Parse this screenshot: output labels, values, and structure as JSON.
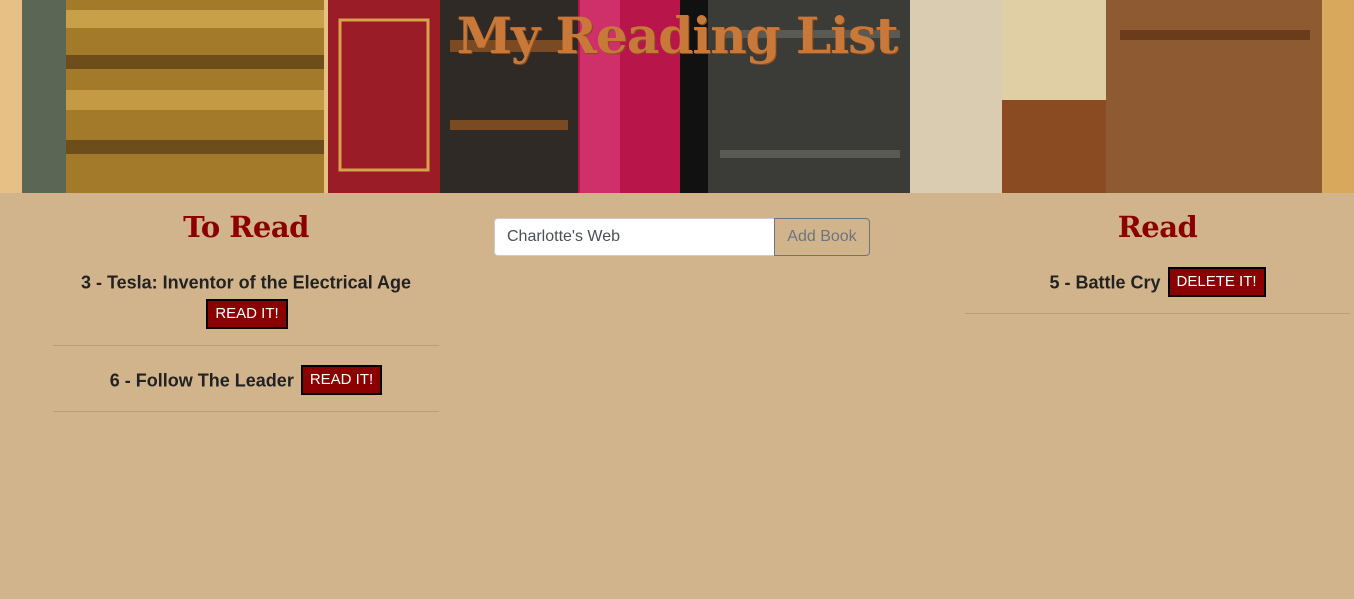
{
  "header": {
    "title": "My Reading List"
  },
  "to_read": {
    "heading": "To Read",
    "items": [
      {
        "label": "3 - Tesla: Inventor of the Electrical Age",
        "action": "READ IT!"
      },
      {
        "label": "6 - Follow The Leader",
        "action": "READ IT!"
      }
    ]
  },
  "add_form": {
    "value": "Charlotte's Web",
    "button": "Add Book"
  },
  "read": {
    "heading": "Read",
    "items": [
      {
        "label": "5 - Battle Cry",
        "action": "DELETE IT!"
      }
    ]
  },
  "colors": {
    "background": "#d2b48c",
    "accent": "#8b0000",
    "title": "#c8793a"
  }
}
